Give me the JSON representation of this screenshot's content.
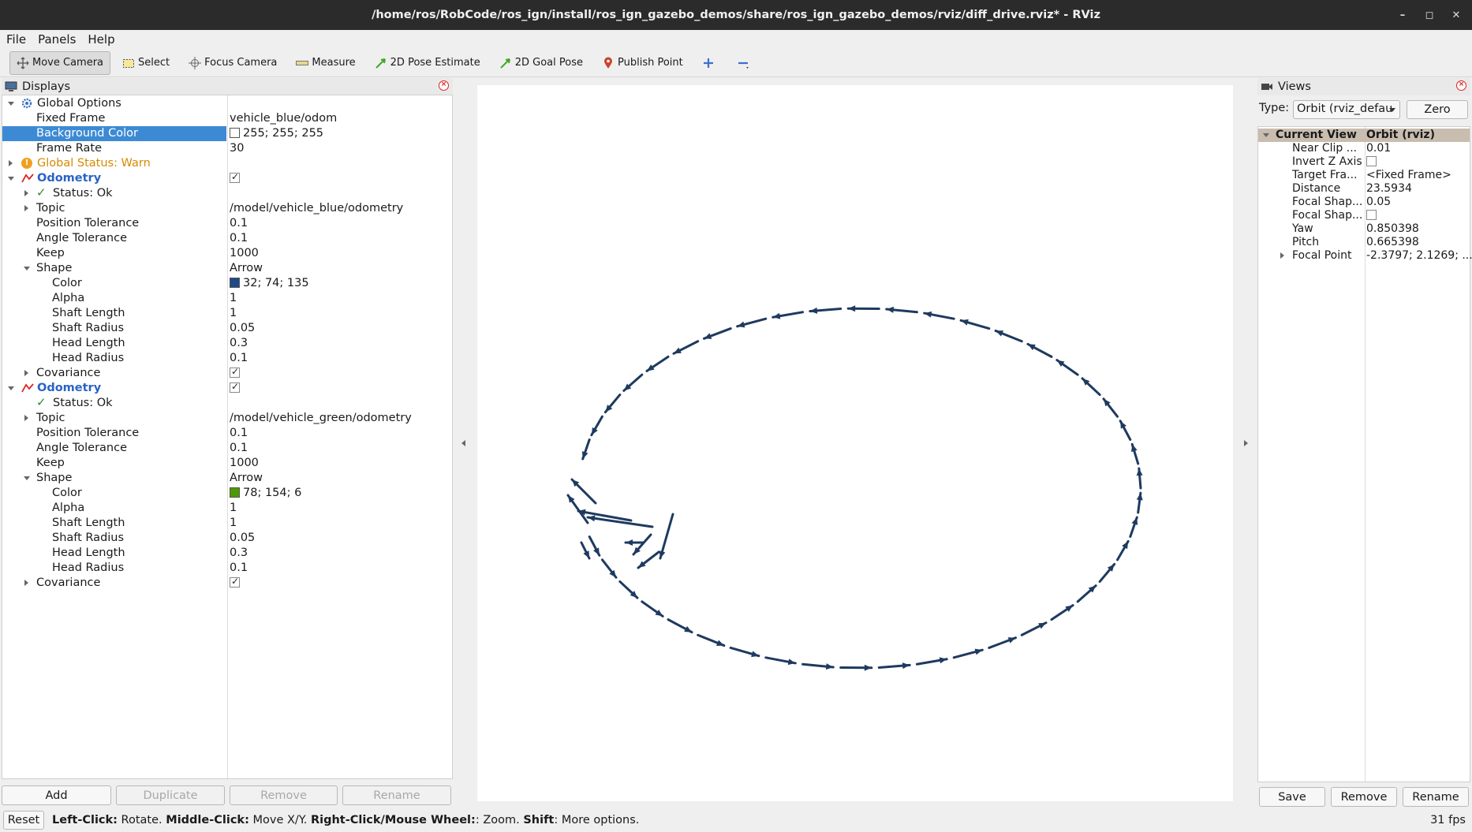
{
  "window": {
    "title": "/home/ros/RobCode/ros_ign/install/ros_ign_gazebo_demos/share/ros_ign_gazebo_demos/rviz/diff_drive.rviz* - RViz"
  },
  "menu": [
    "File",
    "Panels",
    "Help"
  ],
  "toolbar": {
    "move_camera": "Move Camera",
    "select": "Select",
    "focus_camera": "Focus Camera",
    "measure": "Measure",
    "pose_estimate": "2D Pose Estimate",
    "goal_pose": "2D Goal Pose",
    "publish_point": "Publish Point"
  },
  "displays": {
    "title": "Displays",
    "global_options": "Global Options",
    "fixed_frame_label": "Fixed Frame",
    "fixed_frame": "vehicle_blue/odom",
    "bg_color_label": "Background Color",
    "bg_color": "255; 255; 255",
    "bg_color_hex": "#ffffff",
    "frame_rate_label": "Frame Rate",
    "frame_rate": "30",
    "global_status": "Global Status: Warn",
    "odom1": {
      "label": "Odometry",
      "status": "Status: Ok",
      "topic_label": "Topic",
      "topic": "/model/vehicle_blue/odometry",
      "pos_tol_label": "Position Tolerance",
      "pos_tol": "0.1",
      "ang_tol_label": "Angle Tolerance",
      "ang_tol": "0.1",
      "keep_label": "Keep",
      "keep": "1000",
      "shape_label": "Shape",
      "shape": "Arrow",
      "color_label": "Color",
      "color": "32; 74; 135",
      "color_hex": "#204a87",
      "alpha_label": "Alpha",
      "alpha": "1",
      "shaft_len_label": "Shaft Length",
      "shaft_len": "1",
      "shaft_rad_label": "Shaft Radius",
      "shaft_rad": "0.05",
      "head_len_label": "Head Length",
      "head_len": "0.3",
      "head_rad_label": "Head Radius",
      "head_rad": "0.1",
      "covariance_label": "Covariance"
    },
    "odom2": {
      "label": "Odometry",
      "status": "Status: Ok",
      "topic_label": "Topic",
      "topic": "/model/vehicle_green/odometry",
      "pos_tol_label": "Position Tolerance",
      "pos_tol": "0.1",
      "ang_tol_label": "Angle Tolerance",
      "ang_tol": "0.1",
      "keep_label": "Keep",
      "keep": "1000",
      "shape_label": "Shape",
      "shape": "Arrow",
      "color_label": "Color",
      "color": "78; 154; 6",
      "color_hex": "#4e9a06",
      "alpha_label": "Alpha",
      "alpha": "1",
      "shaft_len_label": "Shaft Length",
      "shaft_len": "1",
      "shaft_rad_label": "Shaft Radius",
      "shaft_rad": "0.05",
      "head_len_label": "Head Length",
      "head_len": "0.3",
      "head_rad_label": "Head Radius",
      "head_rad": "0.1",
      "covariance_label": "Covariance"
    },
    "buttons": {
      "add": "Add",
      "duplicate": "Duplicate",
      "remove": "Remove",
      "rename": "Rename"
    }
  },
  "views": {
    "title": "Views",
    "type_label": "Type:",
    "type_value": "Orbit (rviz_defau",
    "zero": "Zero",
    "header_name": "Current View",
    "header_val": "Orbit (rviz)",
    "props": [
      {
        "name": "Near Clip ...",
        "value": "0.01"
      },
      {
        "name": "Invert Z Axis",
        "value": ""
      },
      {
        "name": "Target Fra...",
        "value": "<Fixed Frame>"
      },
      {
        "name": "Distance",
        "value": "23.5934"
      },
      {
        "name": "Focal Shap...",
        "value": "0.05"
      },
      {
        "name": "Focal Shap...",
        "value": ""
      },
      {
        "name": "Yaw",
        "value": "0.850398"
      },
      {
        "name": "Pitch",
        "value": "0.665398"
      },
      {
        "name": "Focal Point",
        "value": "-2.3797; 2.1269; ..."
      }
    ],
    "buttons": {
      "save": "Save",
      "remove": "Remove",
      "rename": "Rename"
    }
  },
  "status": {
    "reset": "Reset",
    "left_click": "Left-Click:",
    "left_click_desc": " Rotate. ",
    "middle_click": "Middle-Click:",
    "middle_click_desc": " Move X/Y. ",
    "right_click": "Right-Click/Mouse Wheel:",
    "right_click_desc": ": Zoom. ",
    "shift": "Shift",
    "shift_desc": ": More options.",
    "fps": "31 fps"
  },
  "arrow_color": "#1e3a5f"
}
